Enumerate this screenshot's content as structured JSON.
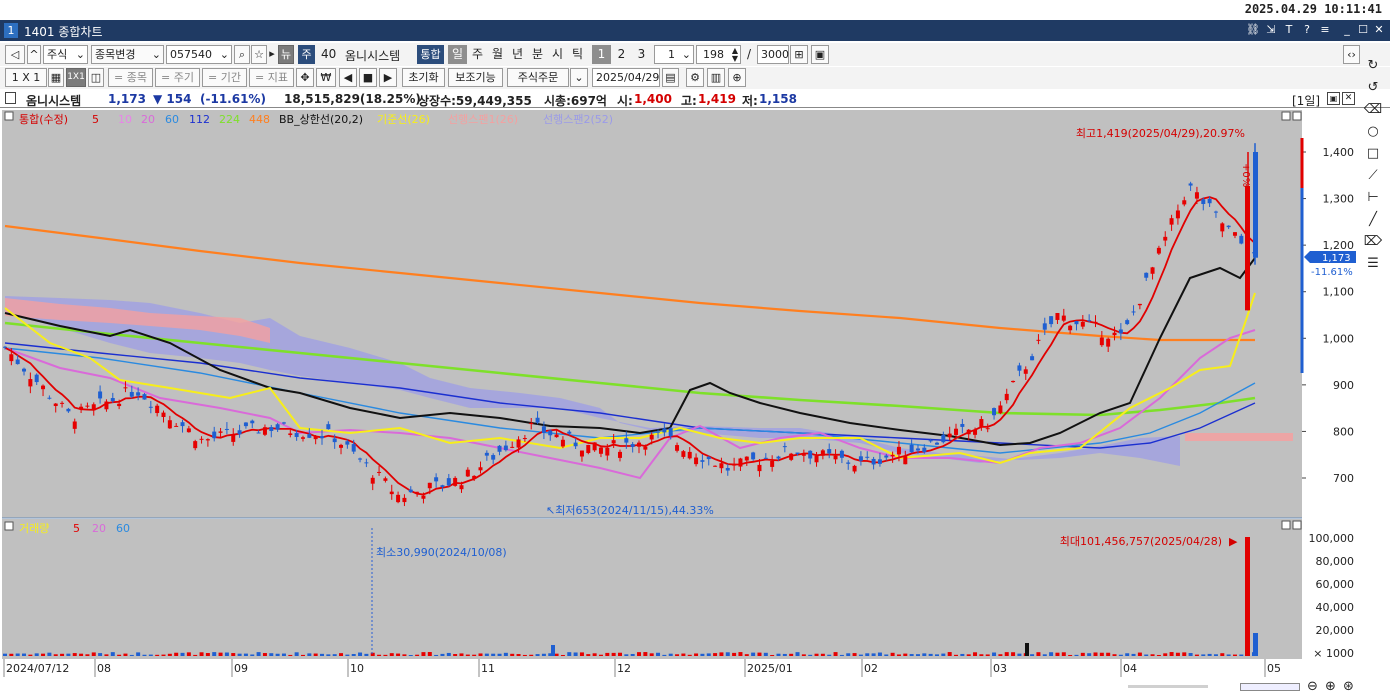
{
  "clock": "2025.04.29 10:11:41",
  "window": {
    "number": "1",
    "title": "1401 종합차트"
  },
  "toolbar1": {
    "nav_prev": "◁",
    "up": "^",
    "type_select": "주식",
    "change_button": "종목변경",
    "code": "057540",
    "news_button": "뉴",
    "market_badge": "주",
    "count_label": "40",
    "stock_name": "옴니시스템",
    "integrated_button": "통합",
    "periods": [
      "일",
      "주",
      "월",
      "년",
      "분",
      "시",
      "틱"
    ],
    "period_numbers": [
      "1",
      "2",
      "3"
    ],
    "period_value": "1",
    "count_value": "198",
    "slash": "/",
    "max_value": "3000"
  },
  "toolbar2": {
    "layout1": "1 X 1",
    "layout2": "1X1",
    "item_btn": "= 종목",
    "cycle_btn": "= 주기",
    "period_btn": "= 기간",
    "indicator_btn": "= 지표",
    "reset_btn": "초기화",
    "aux_btn": "보조기능",
    "order_btn": "주식주문",
    "date_value": "2025/04/29"
  },
  "info": {
    "name": "옴니시스템",
    "price": "1,173",
    "change": "▼ 154",
    "change_pct": "(-11.61%)",
    "volume": "18,515,829(18.25%)",
    "listed": "상장수:59,449,355",
    "mcap": "시총:697억",
    "open_label": "시:",
    "open_value": "1,400",
    "high_label": "고:",
    "high_value": "1,419",
    "low_label": "저:",
    "low_value": "1,158",
    "period_tag": "[1일]"
  },
  "legend": {
    "main": "통합(수정)",
    "ma": [
      "5",
      "10",
      "20",
      "60",
      "112",
      "224",
      "448"
    ],
    "bb": "BB_상한선(20,2)",
    "base": "기준선(26)",
    "lead1": "선행스팬1(26)",
    "lead2": "선행스팬2(52)",
    "volume_title": "거래량",
    "volume_ma": [
      "5",
      "20",
      "60"
    ]
  },
  "annotations": {
    "high": "최고1,419(2025/04/29),20.97%",
    "low": "최저653(2024/11/15),44.33%",
    "vol_min": "최소30,990(2024/10/08)",
    "vol_max": "최대101,456,757(2025/04/28)",
    "price_flag": "1,173",
    "pct_flag": "-11.61%",
    "up_tag": "+0%"
  },
  "price_axis": [
    "1,400",
    "1,300",
    "1,200",
    "1,100",
    "1,000",
    "900",
    "800",
    "700"
  ],
  "volume_axis": [
    "100,000",
    "80,000",
    "60,000",
    "40,000",
    "20,000",
    "× 1000"
  ],
  "date_axis": [
    "2024/07/12",
    "08",
    "09",
    "10",
    "11",
    "12",
    "2025/01",
    "02",
    "03",
    "04",
    "05"
  ],
  "colors": {
    "up": "#e60000",
    "down": "#1f5fd1",
    "bg": "#c0c0c0",
    "accent": "#2c4d7c"
  },
  "chart_data": {
    "type": "candlestick",
    "title": "",
    "x_range": [
      "2024/07/12",
      "2025/04/29"
    ],
    "ylim": [
      630,
      1450
    ],
    "price_points": [
      {
        "date": "2024/07/12",
        "close": 980
      },
      {
        "date": "2024/08/05",
        "close": 830
      },
      {
        "date": "2024/08/20",
        "close": 890
      },
      {
        "date": "2024/09/10",
        "close": 780
      },
      {
        "date": "2024/10/01",
        "close": 810
      },
      {
        "date": "2024/10/20",
        "close": 790
      },
      {
        "date": "2024/11/15",
        "close": 660
      },
      {
        "date": "2024/12/01",
        "close": 700
      },
      {
        "date": "2024/12/10",
        "close": 810
      },
      {
        "date": "2024/12/25",
        "close": 760
      },
      {
        "date": "2025/01/15",
        "close": 790
      },
      {
        "date": "2025/02/01",
        "close": 720
      },
      {
        "date": "2025/02/20",
        "close": 760
      },
      {
        "date": "2025/03/05",
        "close": 730
      },
      {
        "date": "2025/03/20",
        "close": 770
      },
      {
        "date": "2025/04/05",
        "close": 820
      },
      {
        "date": "2025/04/15",
        "close": 1050
      },
      {
        "date": "2025/04/22",
        "close": 1000
      },
      {
        "date": "2025/04/28",
        "close": 1327
      },
      {
        "date": "2025/04/29",
        "close": 1173
      }
    ],
    "high": 1419,
    "low": 653,
    "volume_max": 101456757,
    "volume_min": 30990,
    "volume_ylim": [
      0,
      110000
    ]
  }
}
